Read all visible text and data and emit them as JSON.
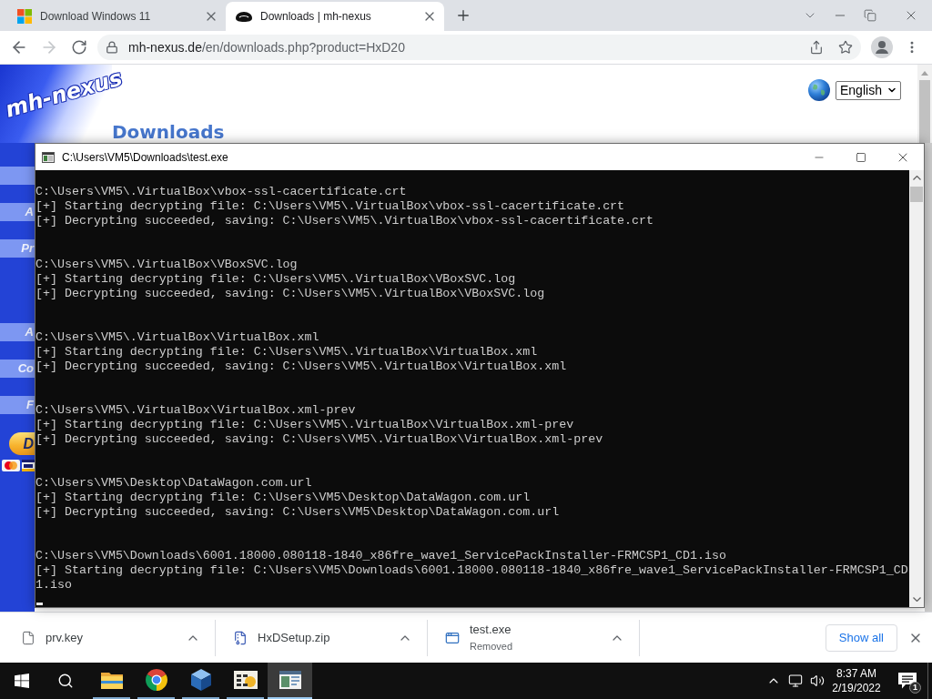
{
  "browser": {
    "tabs": [
      {
        "title": "Download Windows 11",
        "selected": false
      },
      {
        "title": "Downloads | mh-nexus",
        "selected": true
      }
    ],
    "forward_disabled": true,
    "address": {
      "host": "mh-nexus.de",
      "path": "/en/downloads.php?product=HxD20"
    }
  },
  "page": {
    "logo": "mh-nexus",
    "heading": "Downloads",
    "language": "English",
    "nav_top": [
      "A",
      "Pr"
    ],
    "nav_bottom": [
      "A",
      "Co",
      "F"
    ],
    "donate_button": "D"
  },
  "console": {
    "title": "C:\\Users\\VM5\\Downloads\\test.exe",
    "entries": [
      {
        "path": "C:\\Users\\VM5\\.VirtualBox\\vbox-ssl-cacertificate.crt",
        "messages": [
          "[+] Starting decrypting file: C:\\Users\\VM5\\.VirtualBox\\vbox-ssl-cacertificate.crt",
          "[+] Decrypting succeeded, saving: C:\\Users\\VM5\\.VirtualBox\\vbox-ssl-cacertificate.crt"
        ]
      },
      {
        "path": "C:\\Users\\VM5\\.VirtualBox\\VBoxSVC.log",
        "messages": [
          "[+] Starting decrypting file: C:\\Users\\VM5\\.VirtualBox\\VBoxSVC.log",
          "[+] Decrypting succeeded, saving: C:\\Users\\VM5\\.VirtualBox\\VBoxSVC.log"
        ]
      },
      {
        "path": "C:\\Users\\VM5\\.VirtualBox\\VirtualBox.xml",
        "messages": [
          "[+] Starting decrypting file: C:\\Users\\VM5\\.VirtualBox\\VirtualBox.xml",
          "[+] Decrypting succeeded, saving: C:\\Users\\VM5\\.VirtualBox\\VirtualBox.xml"
        ]
      },
      {
        "path": "C:\\Users\\VM5\\.VirtualBox\\VirtualBox.xml-prev",
        "messages": [
          "[+] Starting decrypting file: C:\\Users\\VM5\\.VirtualBox\\VirtualBox.xml-prev",
          "[+] Decrypting succeeded, saving: C:\\Users\\VM5\\.VirtualBox\\VirtualBox.xml-prev"
        ]
      },
      {
        "path": "C:\\Users\\VM5\\Desktop\\DataWagon.com.url",
        "messages": [
          "[+] Starting decrypting file: C:\\Users\\VM5\\Desktop\\DataWagon.com.url",
          "[+] Decrypting succeeded, saving: C:\\Users\\VM5\\Desktop\\DataWagon.com.url"
        ]
      },
      {
        "path": "C:\\Users\\VM5\\Downloads\\6001.18000.080118-1840_x86fre_wave1_ServicePackInstaller-FRMCSP1_CD1.iso",
        "messages": [
          "[+] Starting decrypting file: C:\\Users\\VM5\\Downloads\\6001.18000.080118-1840_x86fre_wave1_ServicePackInstaller-FRMCSP1_CD1.iso"
        ]
      }
    ]
  },
  "downloads": {
    "items": [
      {
        "kind": "file",
        "name": "prv.key"
      },
      {
        "kind": "archive",
        "name": "HxDSetup.zip"
      },
      {
        "kind": "program",
        "name": "test.exe",
        "status": "Removed"
      }
    ],
    "show_all": "Show all"
  },
  "taskbar": {
    "apps": [
      {
        "kind": "folder",
        "selected": false
      },
      {
        "kind": "browser",
        "selected": false
      },
      {
        "kind": "virtual-machine",
        "selected": false
      },
      {
        "kind": "hex-editor",
        "selected": false
      },
      {
        "kind": "console",
        "selected": true
      }
    ],
    "time": "8:37 AM",
    "date": "2/19/2022",
    "notifications": "1"
  }
}
